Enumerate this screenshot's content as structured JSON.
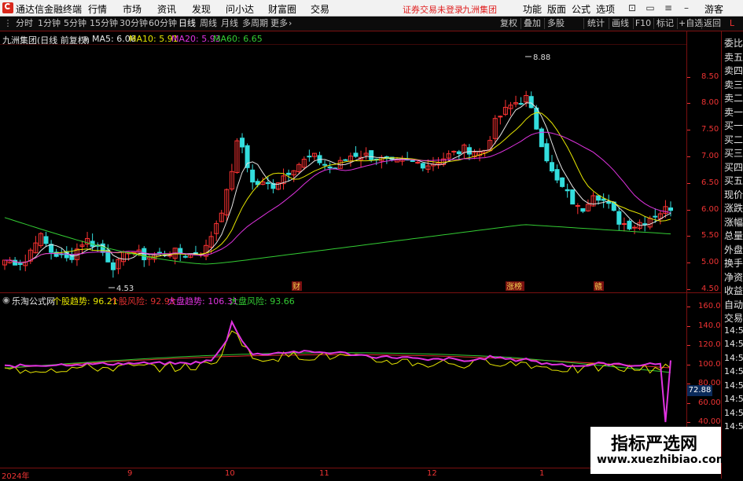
{
  "app": {
    "title": "通达信金融终端",
    "menu": [
      "行情",
      "市场",
      "资讯",
      "发现",
      "问小达",
      "财富圈",
      "交易"
    ],
    "notice": "证券交易未登录",
    "stock_short": "九洲集团",
    "right_menu": [
      "功能",
      "版面",
      "公式",
      "选项"
    ],
    "user": "游客"
  },
  "toolbar": {
    "periods": [
      "分时",
      "1分钟",
      "5分钟",
      "15分钟",
      "30分钟",
      "60分钟",
      "日线",
      "周线",
      "月线",
      "多周期",
      "更多"
    ],
    "active_period": "日线",
    "buttons": [
      "复权",
      "叠加",
      "多股",
      "统计",
      "画线",
      "F10",
      "标记",
      "+自选",
      "返回"
    ]
  },
  "main_chart": {
    "stock": "九洲集团(日线 前复权)",
    "ma": [
      {
        "label": "MA5: 6.06",
        "color": "#e6e6e6"
      },
      {
        "label": "MA10: 5.91",
        "color": "#e6e600"
      },
      {
        "label": "MA20: 5.93",
        "color": "#e033e0"
      },
      {
        "label": "MA60: 6.65",
        "color": "#33cc33"
      }
    ],
    "y_ticks": [
      "8.50",
      "8.00",
      "7.50",
      "7.00",
      "6.50",
      "6.00",
      "5.50",
      "5.00",
      "4.50"
    ],
    "y_values": [
      8.5,
      8.0,
      7.5,
      7.0,
      6.5,
      6.0,
      5.5,
      5.0,
      4.5
    ],
    "high_label": "8.88",
    "low_label": "4.53",
    "markers": [
      "财",
      "涨榜",
      "赣"
    ]
  },
  "indicator": {
    "name": "乐淘公式网",
    "items": [
      {
        "label": "个股趋势: 96.21",
        "color": "#e6e600"
      },
      {
        "label": "个股风险: 92.93",
        "color": "#e03030"
      },
      {
        "label": "大盘趋势: 106.31",
        "color": "#e033e0"
      },
      {
        "label": "大盘风险: 93.66",
        "color": "#33cc33"
      }
    ],
    "y_ticks": [
      "160.0",
      "140.0",
      "120.0",
      "100.0",
      "80.00",
      "60.00",
      "40.00"
    ],
    "y_values": [
      160,
      140,
      120,
      100,
      80,
      60,
      40
    ],
    "current_value": "72.88"
  },
  "x_axis": [
    "2024年",
    "9",
    "10",
    "11",
    "12",
    "1"
  ],
  "right_panel": {
    "items": [
      "委比",
      "卖五",
      "卖四",
      "卖三",
      "卖二",
      "卖一",
      "买一",
      "买二",
      "买三",
      "买四",
      "买五",
      "现价",
      "涨跌",
      "涨幅",
      "总量",
      "外盘",
      "换手",
      "净资",
      "收益",
      "自动",
      "交易",
      "14:50",
      "14:50",
      "14:50",
      "14:50",
      "14:50",
      "14:50",
      "14:50",
      "14:50"
    ]
  },
  "watermark": {
    "title": "指标严选网",
    "url": "www.xuezhibiao.com"
  },
  "colors": {
    "up": "#ff3333",
    "down": "#33dddd",
    "accent": "#7a1010"
  }
}
